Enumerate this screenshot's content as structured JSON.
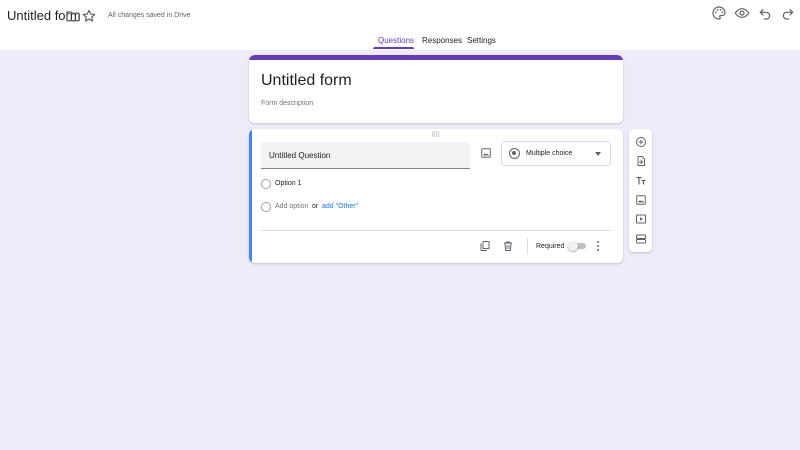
{
  "header": {
    "title": "Untitled form",
    "save_status": "All changes saved in Drive",
    "icons": [
      "folder-icon",
      "star-icon",
      "palette-icon",
      "preview-icon",
      "undo-icon",
      "redo-icon"
    ]
  },
  "tabs": [
    {
      "label": "Questions",
      "active": true
    },
    {
      "label": "Responses",
      "active": false
    },
    {
      "label": "Settings",
      "active": false
    }
  ],
  "form": {
    "title": "Untitled form",
    "description_placeholder": "Form description"
  },
  "question": {
    "title": "Untitled Question",
    "type": "Multiple choice",
    "options": [
      "Option 1"
    ],
    "add_option_label": "Add option",
    "or_label": "or",
    "add_other_label": "add \"Other\"",
    "required_label": "Required",
    "required": false
  },
  "side_toolbar": {
    "icons": [
      "add-question-icon",
      "import-questions-icon",
      "add-title-icon",
      "add-image-icon",
      "add-video-icon",
      "add-section-icon"
    ]
  },
  "colors": {
    "accent": "#673ab7",
    "background": "#f0ebf8",
    "active_card_stripe": "#4285f4",
    "link": "#1a73e8"
  }
}
